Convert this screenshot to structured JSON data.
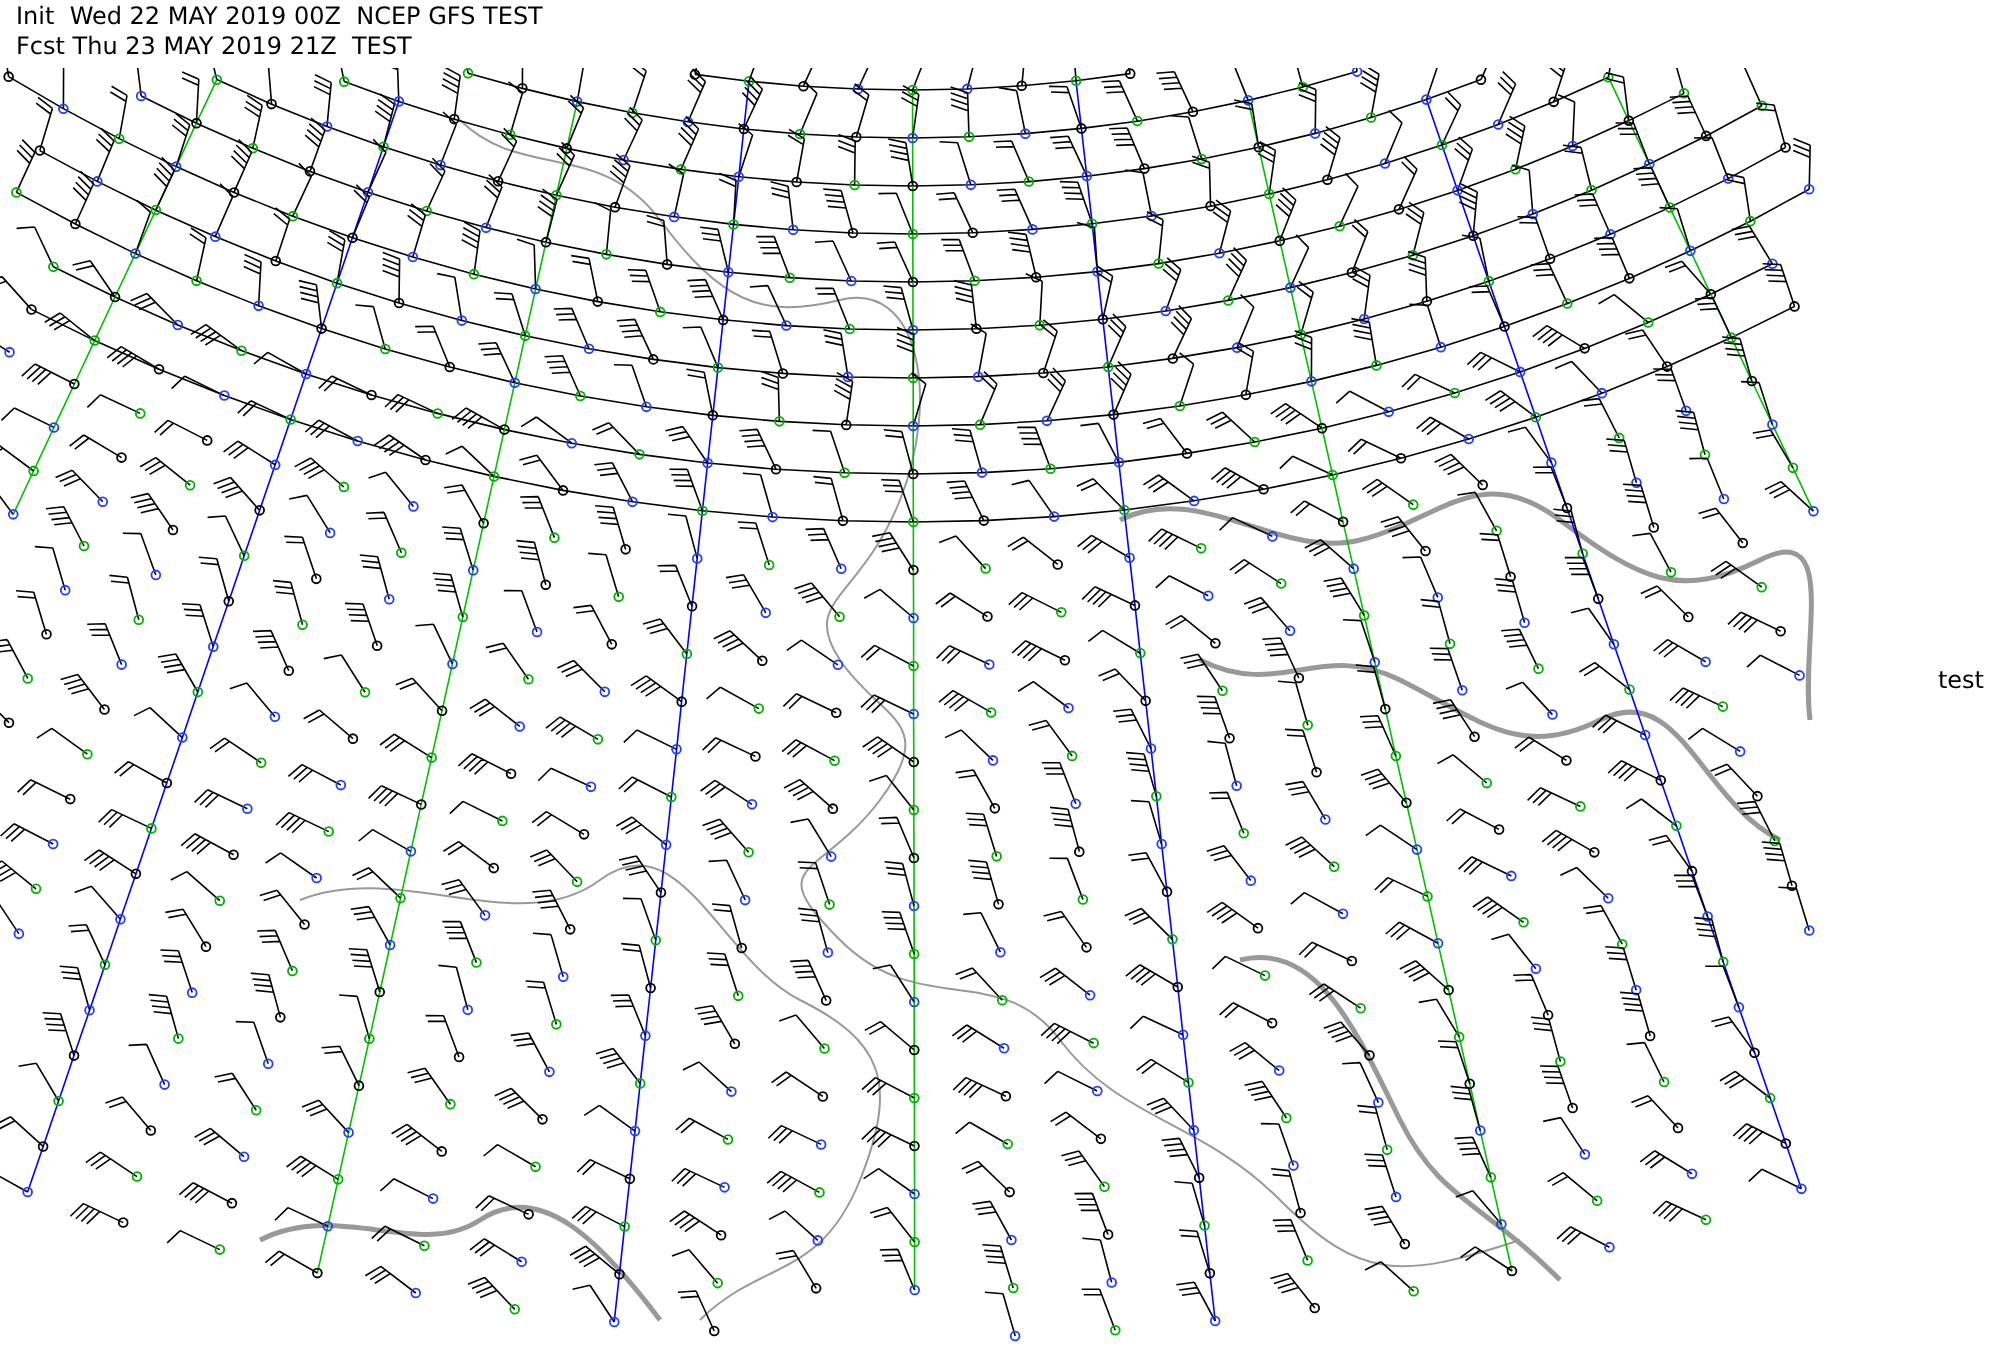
{
  "header": {
    "init_line": "Init  Wed 22 MAY 2019 00Z  NCEP GFS TEST",
    "fcst_line": "Fcst Thu 23 MAY 2019 21Z  TEST"
  },
  "side_label": "test"
}
